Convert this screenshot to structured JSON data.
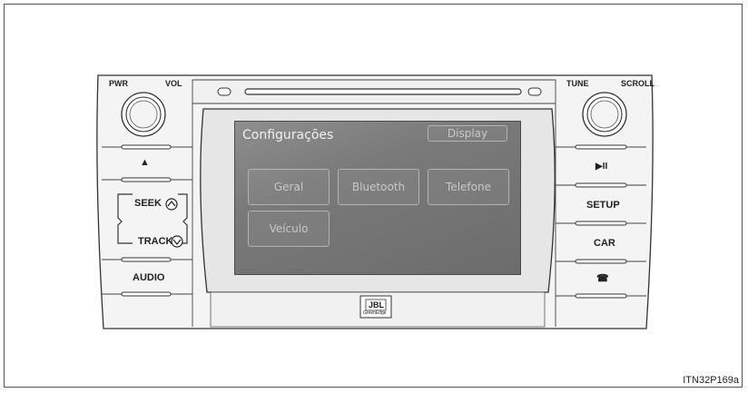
{
  "left_panel": {
    "pwr_label": "PWR",
    "vol_label": "VOL",
    "eject_glyph": "▲",
    "seek_label": "SEEK",
    "track_label": "TRACK",
    "audio_label": "AUDIO"
  },
  "right_panel": {
    "tune_label": "TUNE",
    "scroll_label": "SCROLL",
    "play_pause_glyph": "▶II",
    "setup_label": "SETUP",
    "car_label": "CAR",
    "phone_glyph": "☎"
  },
  "screen": {
    "title": "Configurações",
    "display_button": "Display",
    "menu": [
      {
        "label": "Geral"
      },
      {
        "label": "Bluetooth"
      },
      {
        "label": "Telefone"
      },
      {
        "label": "Veículo"
      }
    ]
  },
  "brand": {
    "logo": "JBL",
    "sub": "GreenEdge"
  },
  "caption": "ITN32P169a"
}
